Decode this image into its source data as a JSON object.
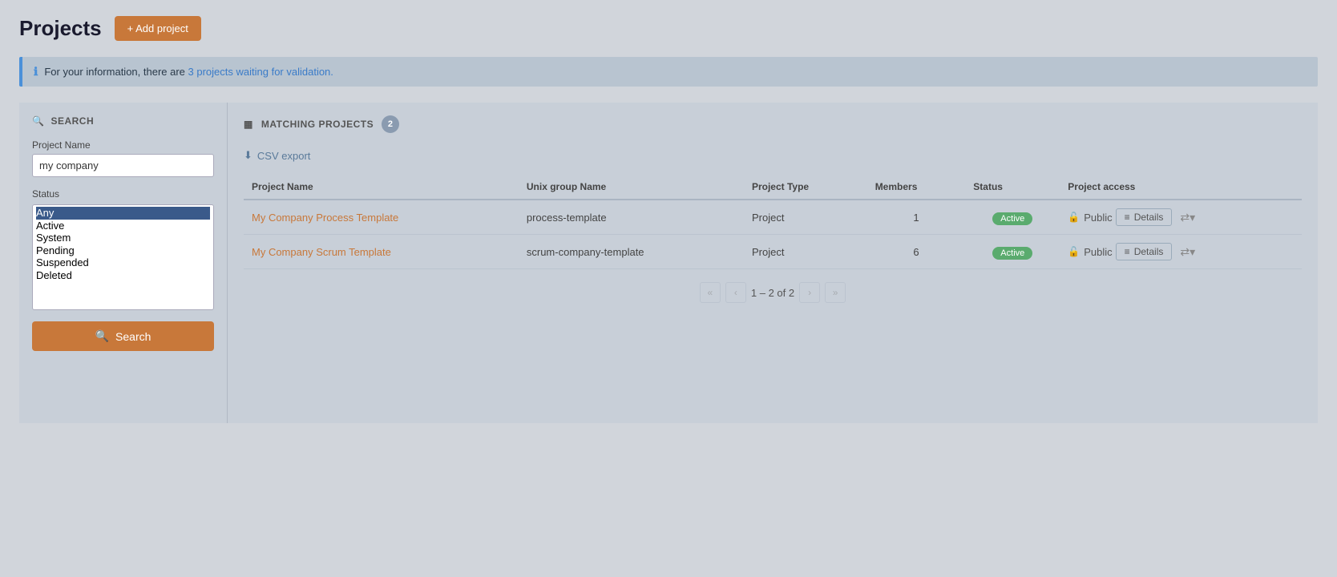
{
  "page": {
    "title": "Projects",
    "add_button_label": "+ Add project",
    "info_banner": {
      "text_before": "For your information, there are ",
      "link_text": "3 projects waiting for validation.",
      "link_href": "#"
    }
  },
  "search_panel": {
    "heading": "SEARCH",
    "project_name_label": "Project Name",
    "project_name_value": "my company",
    "project_name_placeholder": "",
    "status_label": "Status",
    "status_options": [
      "Any",
      "Active",
      "System",
      "Pending",
      "Suspended",
      "Deleted"
    ],
    "status_selected": "Any",
    "search_button_label": "Search"
  },
  "results_panel": {
    "heading": "MATCHING PROJECTS",
    "count": "2",
    "csv_export_label": "CSV export",
    "columns": [
      "Project Name",
      "Unix group Name",
      "Project Type",
      "Members",
      "Status",
      "Project access"
    ],
    "rows": [
      {
        "project_name": "My Company Process Template",
        "unix_group": "process-template",
        "type": "Project",
        "members": "1",
        "status": "Active",
        "access": "Public"
      },
      {
        "project_name": "My Company Scrum Template",
        "unix_group": "scrum-company-template",
        "type": "Project",
        "members": "6",
        "status": "Active",
        "access": "Public"
      }
    ],
    "details_button_label": "Details",
    "pagination_info": "1 – 2 of 2"
  },
  "colors": {
    "accent": "#c8783a",
    "active_badge": "#5aab6e",
    "link": "#c8783a"
  }
}
